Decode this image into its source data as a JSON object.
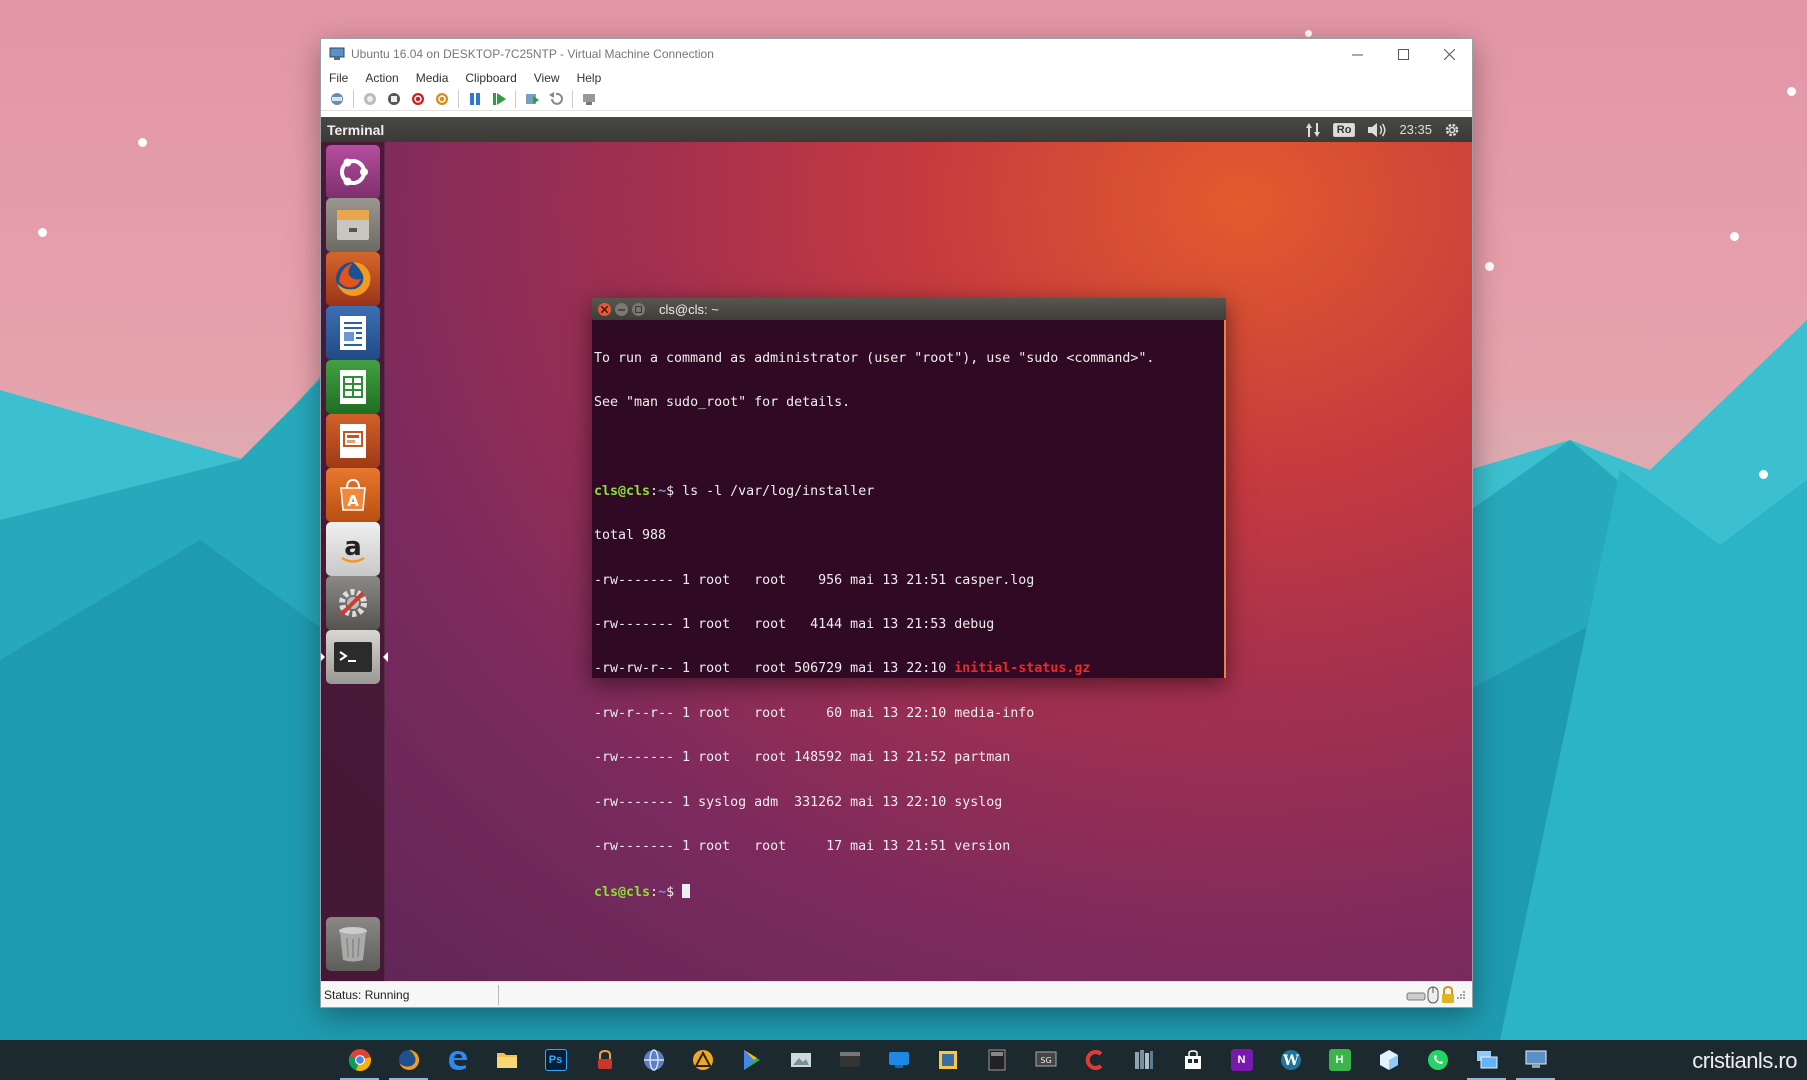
{
  "vm_window": {
    "title": "Ubuntu 16.04 on DESKTOP-7C25NTP - Virtual Machine Connection",
    "menu": [
      "File",
      "Action",
      "Media",
      "Clipboard",
      "View",
      "Help"
    ],
    "status": "Status: Running"
  },
  "ubuntu": {
    "topbar_title": "Terminal",
    "keyboard_layout": "Ro",
    "clock": "23:35",
    "launcher_items": [
      "dash-icon",
      "files-icon",
      "firefox-icon",
      "writer-icon",
      "calc-icon",
      "impress-icon",
      "software-center-icon",
      "amazon-icon",
      "system-settings-icon",
      "terminal-icon",
      "trash-icon"
    ]
  },
  "terminal": {
    "title": "cls@cls: ~",
    "intro_1": "To run a command as administrator (user \"root\"), use \"sudo <command>\".",
    "intro_2": "See \"man sudo_root\" for details.",
    "prompt_user": "cls@cls",
    "prompt_sep": ":",
    "prompt_path": "~",
    "prompt_end": "$ ",
    "command": "ls -l /var/log/installer",
    "total": "total 988",
    "files": [
      {
        "meta": "-rw------- 1 root   root    956 mai 13 21:51 ",
        "name": "casper.log"
      },
      {
        "meta": "-rw------- 1 root   root   4144 mai 13 21:53 ",
        "name": "debug"
      },
      {
        "meta": "-rw-rw-r-- 1 root   root 506729 mai 13 22:10 ",
        "name": "initial-status.gz"
      },
      {
        "meta": "-rw-r--r-- 1 root   root     60 mai 13 22:10 ",
        "name": "media-info"
      },
      {
        "meta": "-rw------- 1 root   root 148592 mai 13 21:52 ",
        "name": "partman"
      },
      {
        "meta": "-rw------- 1 syslog adm  331262 mai 13 22:10 ",
        "name": "syslog"
      },
      {
        "meta": "-rw------- 1 root   root     17 mai 13 21:51 ",
        "name": "version"
      }
    ]
  },
  "taskbar": {
    "watermark": "cristianls.ro"
  }
}
